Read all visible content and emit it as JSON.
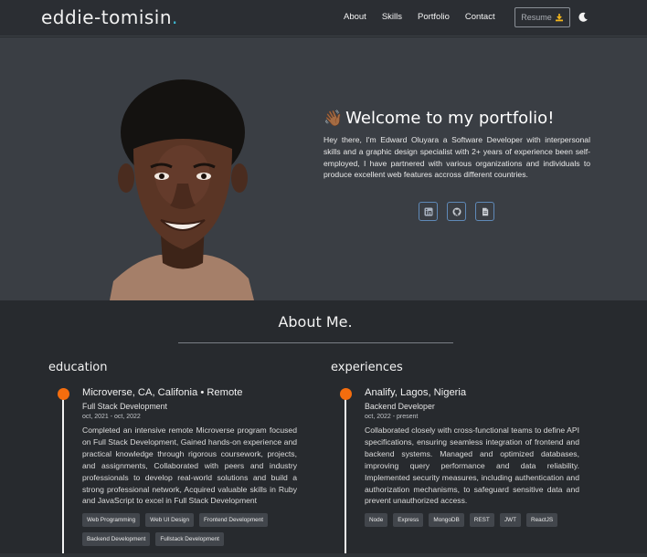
{
  "brand": {
    "name": "eddie-tomisin",
    "dot": "."
  },
  "nav": {
    "links": [
      "About",
      "Skills",
      "Portfolio",
      "Contact"
    ],
    "resume_label": "Resume",
    "theme_toggle_icon": "moon-icon"
  },
  "hero": {
    "wave_emoji": "👋🏾",
    "heading": "Welcome to my portfolio!",
    "intro": "Hey there, I'm Edward Oluyara a Software Developer with interpersonal skills and a graphic design specialist with 2+ years of experience been self-employed, I have partnered with various organizations and individuals to produce excellent web features accross different countries.",
    "socials": [
      "linkedin-icon",
      "github-icon",
      "document-icon"
    ]
  },
  "about": {
    "title": "About Me.",
    "education": {
      "heading": "education",
      "place": "Microverse, CA, Califonia • Remote",
      "role": "Full Stack Development",
      "date": "oct, 2021 - oct, 2022",
      "description": "Completed an intensive remote Microverse program focused on Full Stack Development, Gained hands-on experience and practical knowledge through rigorous coursework, projects, and assignments, Collaborated with peers and industry professionals to develop real-world solutions and build a strong professional network, Acquired valuable skills in Ruby and JavaScript to excel in Full Stack Development",
      "tags": [
        "Web Programming",
        "Web UI Design",
        "Frontend Development",
        "Backend Development",
        "Fullstack Development"
      ]
    },
    "experiences": {
      "heading": "experiences",
      "place": "Analify, Lagos, Nigeria",
      "role": "Backend Developer",
      "date": "oct, 2022 - present",
      "description": "Collaborated closely with cross-functional teams to define API specifications, ensuring seamless integration of frontend and backend systems. Managed and optimized databases, improving query performance and data reliability. Implemented security measures, including authentication and authorization mechanisms, to safeguard sensitive data and prevent unauthorized access.",
      "tags": [
        "Node",
        "Express",
        "MongoDB",
        "REST",
        "JWT",
        "ReactJS"
      ]
    }
  },
  "colors": {
    "accent_orange": "#f46d0e",
    "accent_cyan": "#3db9d3",
    "hero_bg": "#3a3e44",
    "page_bg": "#272a2e"
  }
}
